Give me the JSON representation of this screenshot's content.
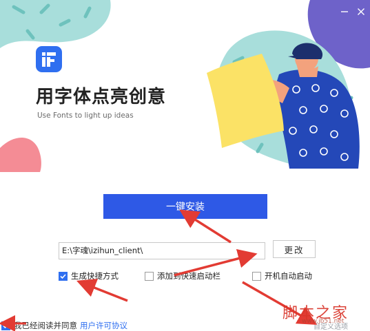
{
  "window": {
    "minimize_icon": "minimize-icon",
    "close_icon": "close-icon"
  },
  "branding": {
    "logo_icon": "ifonts-logo-icon",
    "headline": "用字体点亮创意",
    "subline": "Use Fonts to light up ideas"
  },
  "install": {
    "button_label": "一键安装",
    "path_value": "E:\\字魂\\izihun_client\\",
    "change_label": "更改"
  },
  "options": [
    {
      "label": "生成快捷方式",
      "checked": true
    },
    {
      "label": "添加到快速启动栏",
      "checked": false
    },
    {
      "label": "开机自动启动",
      "checked": false
    }
  ],
  "agreement": {
    "text": "我已经阅读并同意",
    "link": "用户许可协议",
    "checked": true
  },
  "custom_link": "自定义选项",
  "watermark": {
    "text": "脚本之家",
    "sub": "www.jb51.net"
  },
  "colors": {
    "accent": "#2e59e6",
    "logo": "#2f6ff0",
    "arrow": "#e23b33",
    "teal_blob": "#a8dedb",
    "pink_blob": "#f48c95",
    "purple_blob": "#6e62c9"
  }
}
